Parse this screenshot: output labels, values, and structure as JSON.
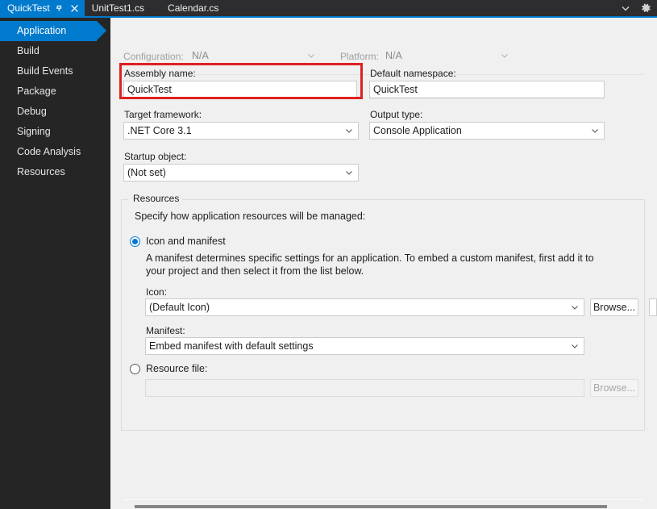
{
  "window": {
    "tabs": [
      {
        "label": "QuickTest",
        "active": true,
        "pinned": true,
        "closable": true
      },
      {
        "label": "UnitTest1.cs",
        "active": false
      },
      {
        "label": "Calendar.cs",
        "active": false
      }
    ],
    "tabstrip_buttons": [
      {
        "name": "tab-list-dropdown",
        "glyph": "chevron-down-icon"
      },
      {
        "name": "tab-settings",
        "glyph": "gear-icon"
      }
    ],
    "accent_color": "#007acc",
    "tabstrip_bg": "#2d2d30"
  },
  "sidebar": {
    "items": [
      {
        "label": "Application",
        "selected": true
      },
      {
        "label": "Build",
        "selected": false
      },
      {
        "label": "Build Events",
        "selected": false
      },
      {
        "label": "Package",
        "selected": false
      },
      {
        "label": "Debug",
        "selected": false
      },
      {
        "label": "Signing",
        "selected": false
      },
      {
        "label": "Code Analysis",
        "selected": false
      },
      {
        "label": "Resources",
        "selected": false
      }
    ]
  },
  "main": {
    "configuration": {
      "label": "Configuration:",
      "value": "N/A",
      "disabled": true
    },
    "platform": {
      "label": "Platform:",
      "value": "N/A",
      "disabled": true
    },
    "assembly_name": {
      "label": "Assembly name:",
      "value": "QuickTest",
      "highlighted": true,
      "highlight_color": "#e02020"
    },
    "default_namespace": {
      "label": "Default namespace:",
      "value": "QuickTest"
    },
    "target_framework": {
      "label": "Target framework:",
      "value": ".NET Core 3.1"
    },
    "output_type": {
      "label": "Output type:",
      "value": "Console Application"
    },
    "startup_object": {
      "label": "Startup object:",
      "value": "(Not set)"
    },
    "resources": {
      "group_title": "Resources",
      "instruction": "Specify how application resources will be managed:",
      "icon_and_manifest": {
        "label": "Icon and manifest",
        "selected": true,
        "description": "A manifest determines specific settings for an application. To embed a custom manifest, first add it to your project and then select it from the list below.",
        "icon": {
          "label": "Icon:",
          "value": "(Default Icon)",
          "browse_label": "Browse..."
        },
        "manifest": {
          "label": "Manifest:",
          "value": "Embed manifest with default settings"
        }
      },
      "resource_file": {
        "label": "Resource file:",
        "selected": false,
        "value": "",
        "browse_label": "Browse...",
        "disabled": true
      }
    }
  }
}
